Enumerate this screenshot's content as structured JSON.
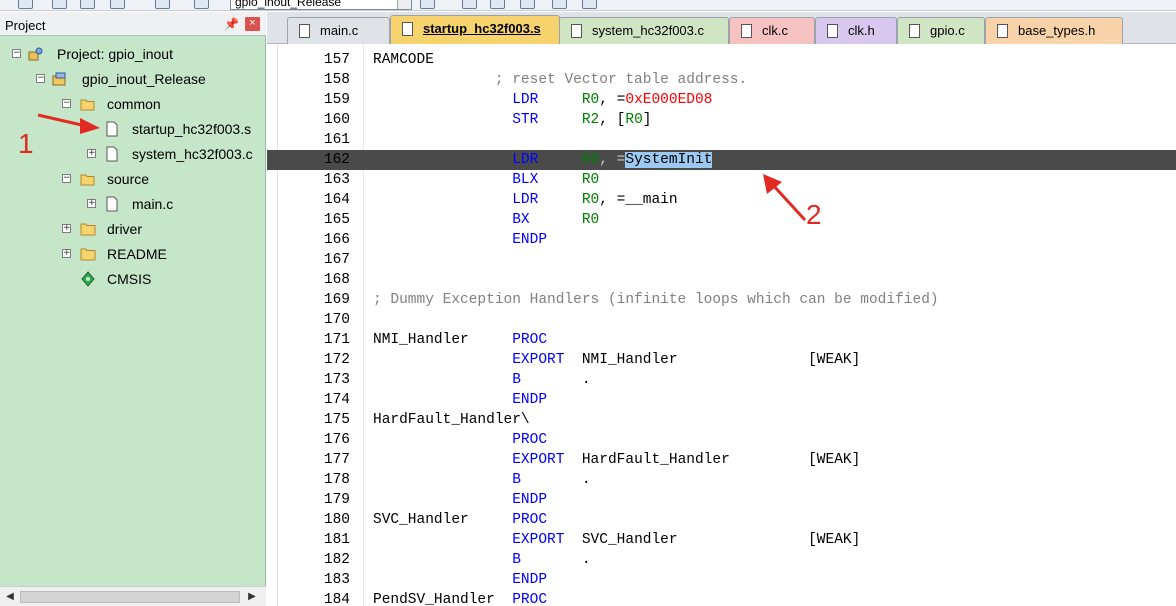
{
  "toolbar": {
    "target_value": "gpio_inout_Release"
  },
  "project_panel": {
    "title": "Project",
    "pin_glyph": "Ť",
    "close_glyph": "×"
  },
  "tree": {
    "project_label": "Project: gpio_inout",
    "target_label": "gpio_inout_Release",
    "group_common": "common",
    "file_startup": "startup_hc32f003.s",
    "file_system": "system_hc32f003.c",
    "group_source": "source",
    "file_main": "main.c",
    "group_driver": "driver",
    "group_readme": "README",
    "group_cmsis": "CMSIS"
  },
  "annotations": {
    "marker1": "1",
    "marker2": "2",
    "color": "#e02a22"
  },
  "tabs": [
    {
      "label": "main.c",
      "color": "#dfe3e8",
      "active": false
    },
    {
      "label": "startup_hc32f003.s",
      "color": "#f6d36d",
      "active": true
    },
    {
      "label": "system_hc32f003.c",
      "color": "#cfe5c3",
      "active": false
    },
    {
      "label": "clk.c",
      "color": "#f7c2c2",
      "active": false
    },
    {
      "label": "clk.h",
      "color": "#d8c8f0",
      "active": false
    },
    {
      "label": "gpio.c",
      "color": "#cfe5c3",
      "active": false
    },
    {
      "label": "base_types.h",
      "color": "#f8d2a8",
      "active": false
    }
  ],
  "code": {
    "line_numbers": [
      "157",
      "158",
      "159",
      "160",
      "161",
      "162",
      "163",
      "164",
      "165",
      "166",
      "167",
      "168",
      "169",
      "170",
      "171",
      "172",
      "173",
      "174",
      "175",
      "176",
      "177",
      "178",
      "179",
      "180",
      "181",
      "182",
      "183",
      "184"
    ],
    "current_line_index": 5,
    "selected_text": "SystemInit"
  }
}
